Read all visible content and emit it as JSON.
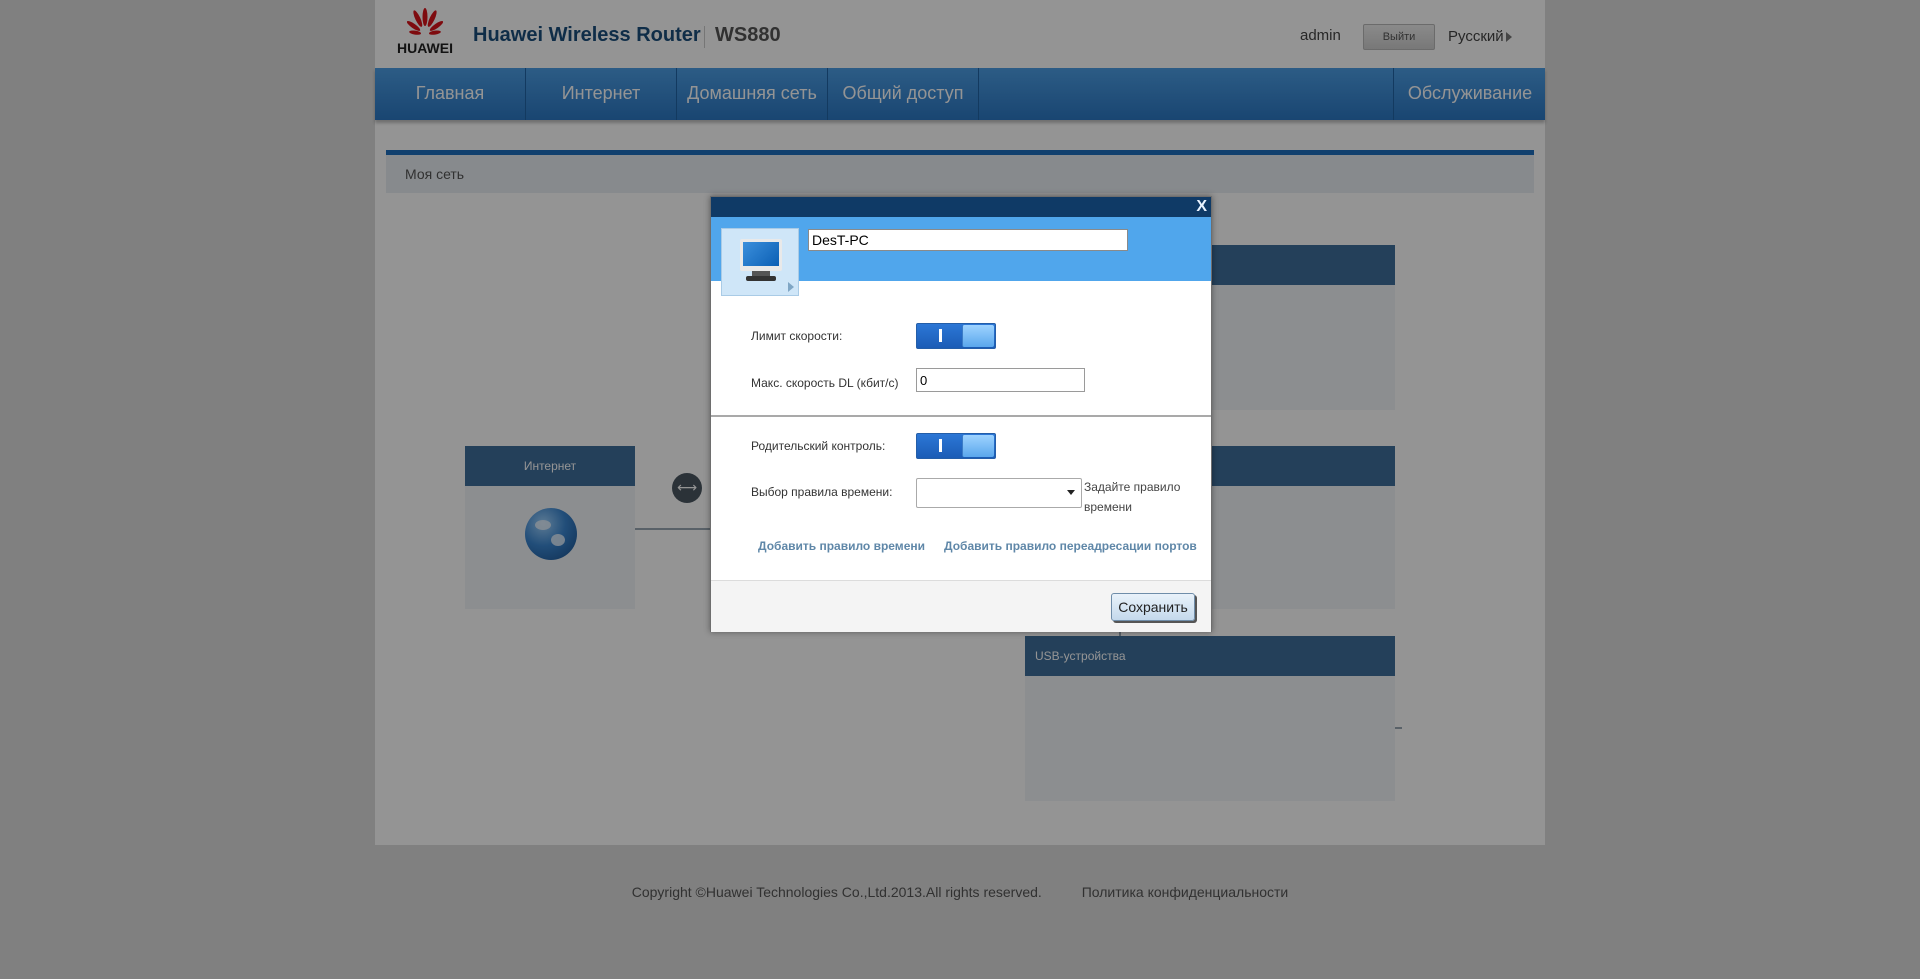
{
  "header": {
    "logo_text": "HUAWEI",
    "product_title": "Huawei Wireless Router",
    "model": "WS880",
    "user": "admin",
    "logout_label": "Выйти",
    "language": "Русский"
  },
  "nav": {
    "items": [
      {
        "label": "Главная"
      },
      {
        "label": "Интернет"
      },
      {
        "label": "Домашняя сеть"
      },
      {
        "label": "Общий доступ"
      }
    ],
    "service_label": "Обслуживание"
  },
  "content": {
    "breadcrumb": "Моя сеть",
    "internet_card_title": "Интернет",
    "usb_card_title": "USB-устройства"
  },
  "dialog": {
    "close_label": "X",
    "device_name": "DesT-PC",
    "speed_limit_label": "Лимит скорости:",
    "max_dl_label": "Макс. скорость DL (кбит/с)",
    "max_dl_value": "0",
    "parental_label": "Родительский контроль:",
    "time_rule_label": "Выбор правила времени:",
    "time_rule_value": "",
    "set_rule_hint": "Задайте правило времени",
    "add_time_rule_link": "Добавить правило времени",
    "add_port_forward_link": "Добавить правило переадресации портов",
    "save_label": "Сохранить",
    "speed_limit_on": true,
    "parental_on": true
  },
  "footer": {
    "copyright": "Copyright ©Huawei Technologies Co.,Ltd.2013.All rights reserved.",
    "privacy": "Политика конфиденциальности"
  },
  "colors": {
    "accent": "#2c78c4",
    "dialog_header": "#50a6ec",
    "dialog_titlebar": "#0f3a66",
    "card_header": "#3f6f9c"
  }
}
